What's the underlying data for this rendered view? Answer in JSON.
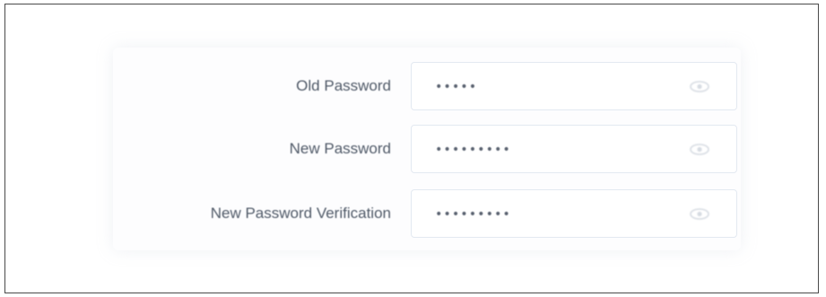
{
  "form": {
    "fields": [
      {
        "label": "Old Password",
        "value": "•••••",
        "icon": "eye-icon"
      },
      {
        "label": "New Password",
        "value": "•••••••••",
        "icon": "eye-icon"
      },
      {
        "label": "New Password Verification",
        "value": "•••••••••",
        "icon": "eye-icon"
      }
    ]
  },
  "colors": {
    "label": "#505a68",
    "field_border": "#e3e9f1",
    "icon": "#d6dbe2",
    "frame_border": "#4a4a4a"
  }
}
